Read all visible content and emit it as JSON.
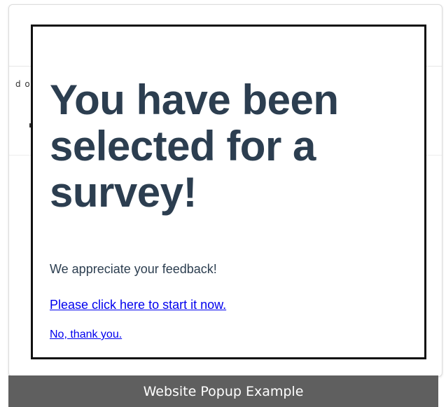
{
  "background_page": {
    "partial_text": "d o"
  },
  "popup": {
    "title": "You have been selected for a survey!",
    "message": "We appreciate your feedback!",
    "start_link": "Please click here to start it now.",
    "decline_link": "No, thank you."
  },
  "caption": {
    "text": "Website Popup Example"
  },
  "colors": {
    "title_text": "#2c3e50",
    "link": "#0000ee",
    "popup_border": "#111111",
    "caption_bg": "#5f5f5f",
    "caption_text": "#ffffff"
  }
}
